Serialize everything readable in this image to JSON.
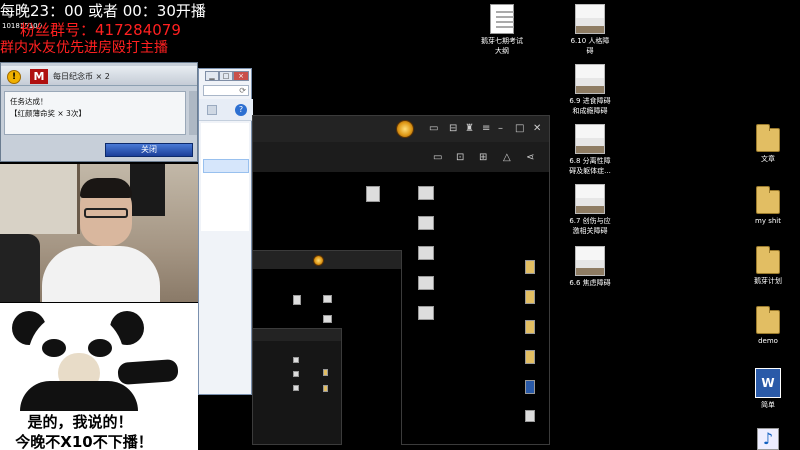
{
  "overlay": {
    "schedule": "每晚23：00 或者 00：30开播",
    "room_id": "101815100",
    "group_no": "粉丝群号：417284079",
    "group_note": "群内水友优先进房殴打主播"
  },
  "dialog": {
    "title": "每日纪念币 × 2",
    "line1": "任务达成！",
    "line2": "【红颜薄命奖 × 3次】",
    "close_label": "关闭"
  },
  "meme": {
    "line1": "是的，我说的！",
    "line2": "今晚不X10不下播！"
  },
  "explorer": {
    "address_icon": "refresh-icon"
  },
  "browser": {
    "toolbar_icons": [
      "screen-icon",
      "bag-icon",
      "shirt-icon",
      "more-icon",
      "minimize-icon",
      "maximize-icon",
      "close-icon"
    ],
    "tool_row_icons": [
      "monitor-icon",
      "lock-icon",
      "box-icon",
      "bell-icon",
      "share-icon"
    ]
  },
  "desktop_icons": [
    {
      "label": "鹅芽七期考试\n大纲",
      "kind": "doc"
    },
    {
      "label": "6.10 人格障\n碍",
      "kind": "thumb"
    },
    {
      "label": "6.9 进食障碍\n和成瘾障碍",
      "kind": "thumb"
    },
    {
      "label": "6.8 分离性障\n碍及躯体症...",
      "kind": "thumb"
    },
    {
      "label": "6.7 创伤与应\n激相关障碍",
      "kind": "thumb"
    },
    {
      "label": "6.6 焦虑障碍",
      "kind": "thumb"
    },
    {
      "label": "文章",
      "kind": "folder"
    },
    {
      "label": "my shit",
      "kind": "folder"
    },
    {
      "label": "鹅芽计划",
      "kind": "folder"
    },
    {
      "label": "demo",
      "kind": "folder"
    },
    {
      "label": "简单",
      "kind": "word"
    },
    {
      "label": "",
      "kind": "music"
    }
  ]
}
